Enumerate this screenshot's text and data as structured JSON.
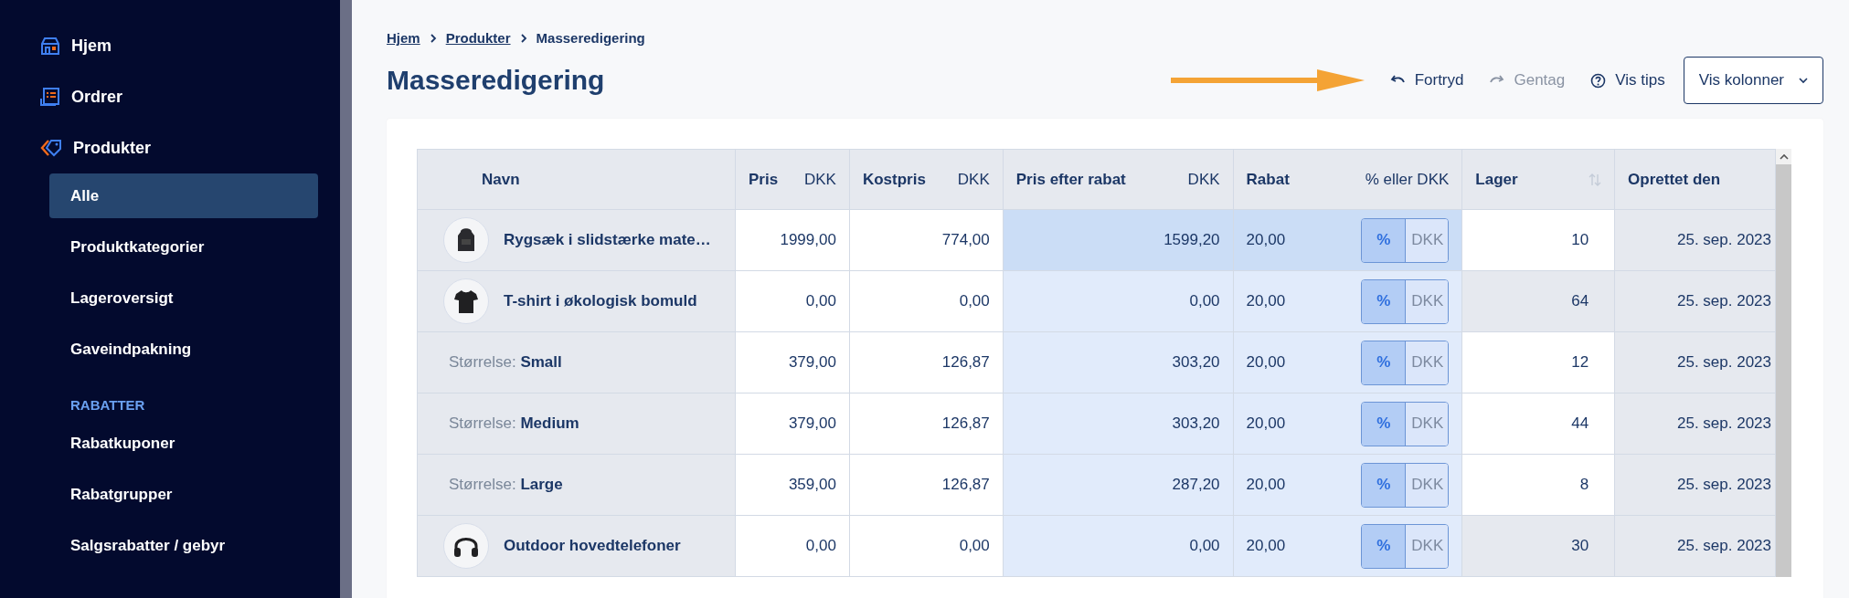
{
  "sidebar": {
    "items": [
      {
        "label": "Hjem"
      },
      {
        "label": "Ordrer"
      },
      {
        "label": "Produkter",
        "children": [
          {
            "label": "Alle",
            "selected": true
          },
          {
            "label": "Produktkategorier",
            "selected": false
          },
          {
            "label": "Lageroversigt",
            "selected": false
          },
          {
            "label": "Gaveindpakning",
            "selected": false
          }
        ]
      }
    ],
    "sections": [
      {
        "heading": "RABATTER",
        "items": [
          {
            "label": "Rabatkuponer",
            "selected": false
          },
          {
            "label": "Rabatgrupper",
            "selected": false
          },
          {
            "label": "Salgsrabatter / gebyr",
            "selected": false
          }
        ]
      }
    ]
  },
  "breadcrumb": [
    "Hjem",
    "Produkter",
    "Masseredigering"
  ],
  "title": "Masseredigering",
  "toolbar": [
    {
      "label": "Fortryd",
      "disabled": false
    },
    {
      "label": "Gentag",
      "disabled": true
    },
    {
      "label": "Vis tips",
      "disabled": false
    }
  ],
  "columns_button": {
    "label": "Vis kolonner"
  },
  "table": {
    "columns": [
      {
        "label": "Navn"
      },
      {
        "label": "Pris",
        "unit": "DKK"
      },
      {
        "label": "Kostpris",
        "unit": "DKK"
      },
      {
        "label": "Pris efter rabat",
        "unit": "DKK"
      },
      {
        "label": "Rabat",
        "unit": "% eller DKK"
      },
      {
        "label": "Lager"
      },
      {
        "label": "Oprettet den"
      }
    ],
    "rows": [
      {
        "kind": "product",
        "name": "Rygsæk i slidstærke mate…",
        "price": "1999,00",
        "cost": "774,00",
        "discounted": "1599,20",
        "discount": "20,00",
        "discount_type": [
          {
            "label": "%",
            "selected": true
          },
          {
            "label": "DKK",
            "selected": false
          }
        ],
        "stock": "10",
        "stock_editable": true,
        "created": "25. sep. 2023",
        "highlighted": true
      },
      {
        "kind": "product",
        "name": "T-shirt i økologisk bomuld",
        "price": "0,00",
        "cost": "0,00",
        "discounted": "0,00",
        "discount": "20,00",
        "discount_type": [
          {
            "label": "%",
            "selected": true
          },
          {
            "label": "DKK",
            "selected": false
          }
        ],
        "stock": "64",
        "stock_editable": false,
        "created": "25. sep. 2023",
        "highlighted": false
      },
      {
        "kind": "variant",
        "attribute": "Størrelse:",
        "value": "Small",
        "price": "379,00",
        "cost": "126,87",
        "discounted": "303,20",
        "discount": "20,00",
        "discount_type": [
          {
            "label": "%",
            "selected": true
          },
          {
            "label": "DKK",
            "selected": false
          }
        ],
        "stock": "12",
        "stock_editable": true,
        "created": "25. sep. 2023",
        "highlighted": false
      },
      {
        "kind": "variant",
        "attribute": "Størrelse:",
        "value": "Medium",
        "price": "379,00",
        "cost": "126,87",
        "discounted": "303,20",
        "discount": "20,00",
        "discount_type": [
          {
            "label": "%",
            "selected": true
          },
          {
            "label": "DKK",
            "selected": false
          }
        ],
        "stock": "44",
        "stock_editable": true,
        "created": "25. sep. 2023",
        "highlighted": false
      },
      {
        "kind": "variant",
        "attribute": "Størrelse:",
        "value": "Large",
        "price": "359,00",
        "cost": "126,87",
        "discounted": "287,20",
        "discount": "20,00",
        "discount_type": [
          {
            "label": "%",
            "selected": true
          },
          {
            "label": "DKK",
            "selected": false
          }
        ],
        "stock": "8",
        "stock_editable": true,
        "created": "25. sep. 2023",
        "highlighted": false
      },
      {
        "kind": "product",
        "name": "Outdoor hovedtelefoner",
        "price": "0,00",
        "cost": "0,00",
        "discounted": "0,00",
        "discount": "20,00",
        "discount_type": [
          {
            "label": "%",
            "selected": true
          },
          {
            "label": "DKK",
            "selected": false
          }
        ],
        "stock": "30",
        "stock_editable": false,
        "created": "25. sep. 2023",
        "highlighted": false
      }
    ]
  }
}
